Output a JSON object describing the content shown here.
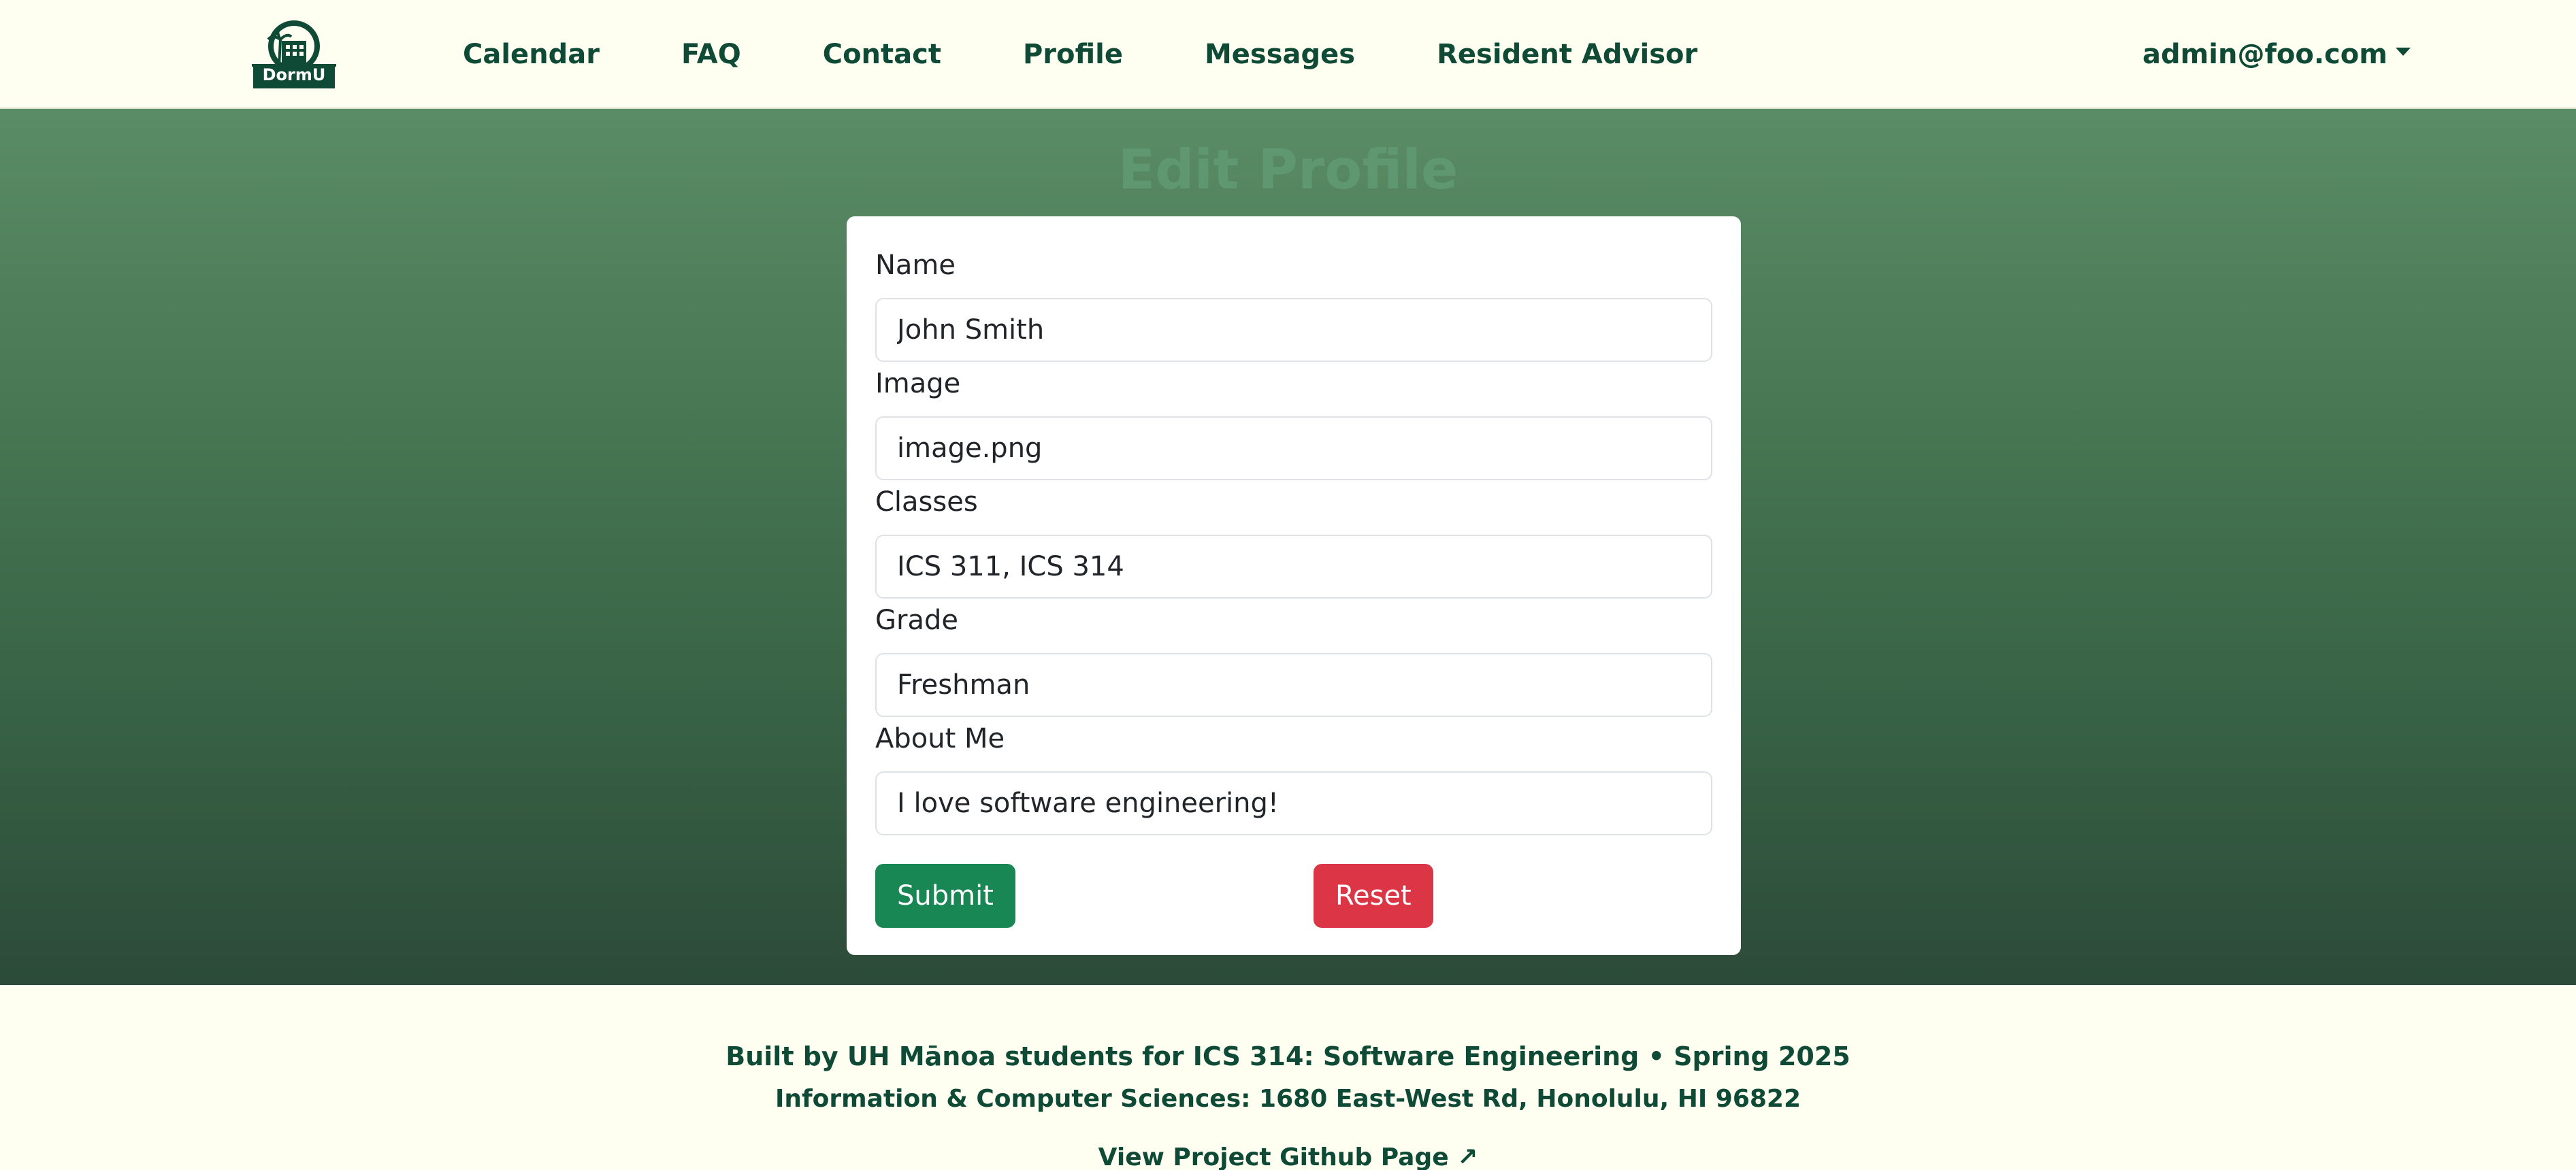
{
  "brand": {
    "logo_text": "DormU"
  },
  "nav": {
    "links": [
      {
        "label": "Calendar"
      },
      {
        "label": "FAQ"
      },
      {
        "label": "Contact"
      },
      {
        "label": "Profile"
      },
      {
        "label": "Messages"
      },
      {
        "label": "Resident Advisor"
      }
    ],
    "user_email": "admin@foo.com"
  },
  "page": {
    "title": "Edit Profile"
  },
  "form": {
    "fields": [
      {
        "label": "Name",
        "value": "John Smith"
      },
      {
        "label": "Image",
        "value": "image.png"
      },
      {
        "label": "Classes",
        "value": "ICS 311, ICS 314"
      },
      {
        "label": "Grade",
        "value": "Freshman"
      },
      {
        "label": "About Me",
        "value": "I love software engineering!"
      }
    ],
    "submit_label": "Submit",
    "reset_label": "Reset"
  },
  "footer": {
    "line1": "Built by UH Mānoa students for ICS 314: Software Engineering • Spring 2025",
    "line2": "Information & Computer Sciences: 1680 East-West Rd, Honolulu, HI 96822",
    "link_label": "View Project Github Page ↗"
  },
  "colors": {
    "brand_dark_green": "#0e4a36",
    "cream": "#fefff0",
    "submit": "#198754",
    "reset": "#dc3545"
  }
}
